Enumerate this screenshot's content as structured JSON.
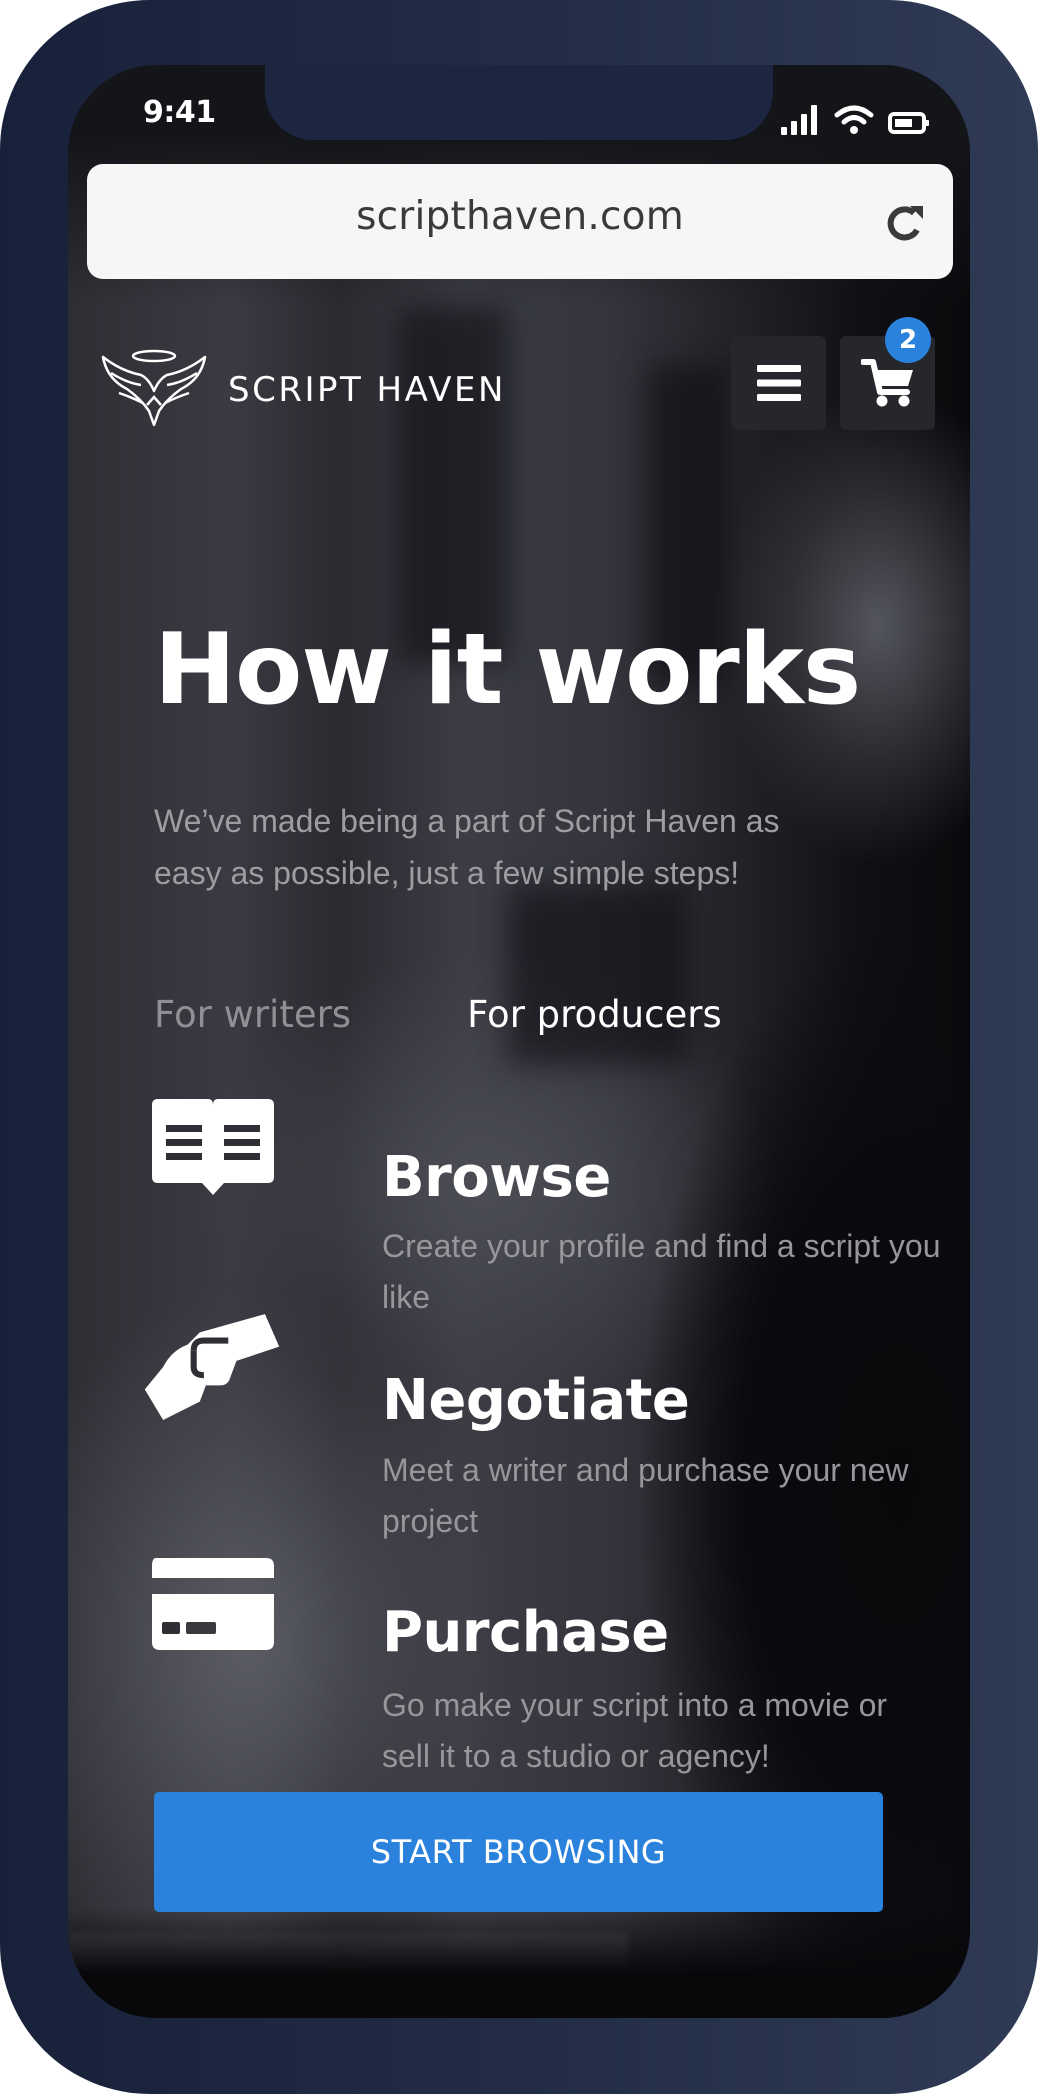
{
  "status_bar": {
    "time": "9:41",
    "icons": [
      "cellular-signal-icon",
      "wifi-icon",
      "battery-icon"
    ]
  },
  "browser": {
    "url": "scripthaven.com",
    "reload_icon": "reload-icon"
  },
  "header": {
    "logo_icon": "winged-halo-logo-icon",
    "brand": "SCRIPT HAVEN",
    "menu_icon": "hamburger-menu-icon",
    "cart_icon": "shopping-cart-icon",
    "cart_count": "2"
  },
  "hero": {
    "title": "How it works",
    "lead": "We’ve made being a part of Script Haven as easy as possible, just a few simple steps!"
  },
  "tabs": [
    {
      "label": "For writers",
      "active": false
    },
    {
      "label": "For producers",
      "active": true
    }
  ],
  "steps": [
    {
      "icon": "open-book-icon",
      "title": "Browse",
      "description": "Create your profile and find a script you like"
    },
    {
      "icon": "handshake-money-icon",
      "title": "Negotiate",
      "description": "Meet a writer and purchase your new project"
    },
    {
      "icon": "credit-card-icon",
      "title": "Purchase",
      "description": "Go make your script into a movie or sell it to a studio or agency!"
    }
  ],
  "cta": {
    "label": "START BROWSING"
  },
  "colors": {
    "accent": "#2b82dc",
    "phone_frame": "#1f2940",
    "url_bar": "#f6f6f6"
  }
}
